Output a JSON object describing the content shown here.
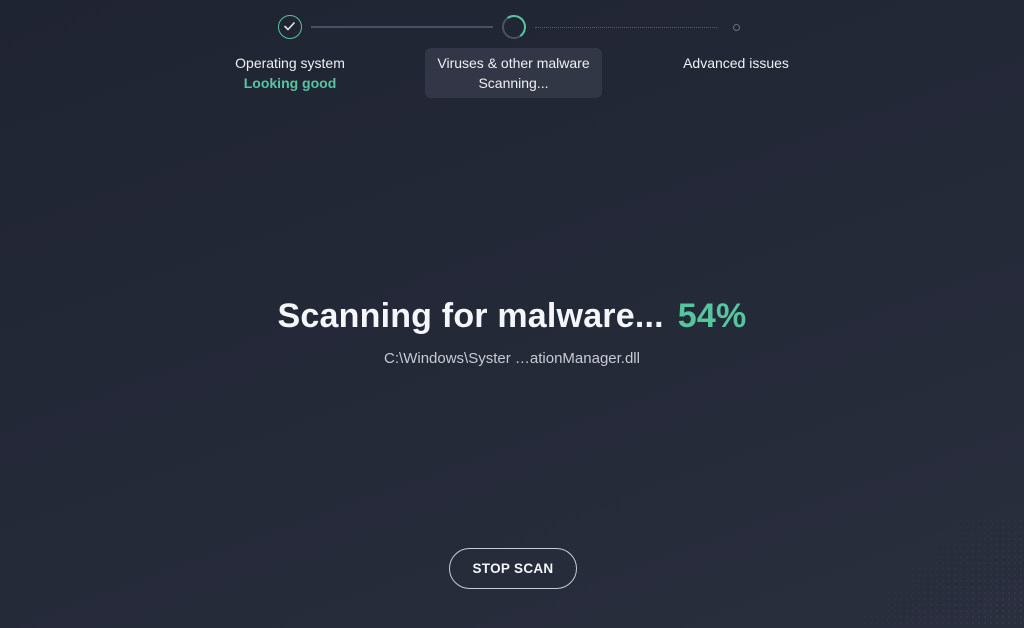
{
  "steps": [
    {
      "title": "Operating system",
      "status": "Looking good",
      "state": "done"
    },
    {
      "title": "Viruses & other malware",
      "status": "Scanning...",
      "state": "active"
    },
    {
      "title": "Advanced issues",
      "status": "",
      "state": "pending"
    }
  ],
  "scan": {
    "heading": "Scanning for malware...",
    "percent": "54%",
    "current_file": "C:\\Windows\\Syster …ationManager.dll"
  },
  "actions": {
    "stop_label": "STOP SCAN"
  },
  "colors": {
    "accent": "#56c5a0",
    "background": "#232837"
  }
}
